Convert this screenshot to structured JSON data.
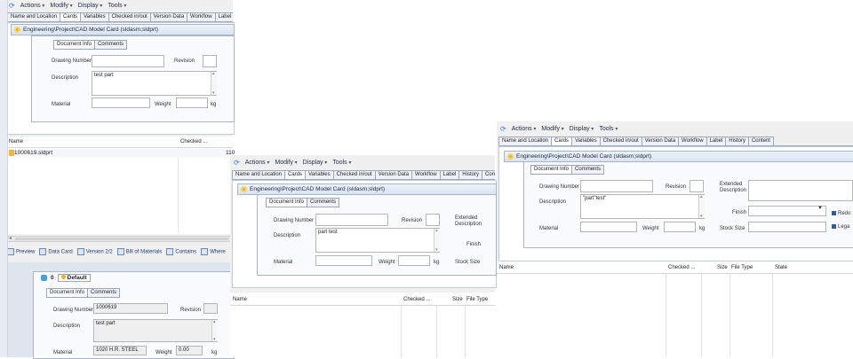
{
  "menu": {
    "actions": "Actions",
    "modify": "Modify",
    "display": "Display",
    "tools": "Tools"
  },
  "tabs": [
    "Name and Location",
    "Cards",
    "Variables",
    "Checked in/out",
    "Version Data",
    "Workflow",
    "Label",
    "History",
    "Content"
  ],
  "tabs_short": [
    "Name and Location",
    "Cards",
    "Variables",
    "Checked in/out",
    "Version Data",
    "Workflow",
    "Label",
    "Hi"
  ],
  "card_title": "Engineering\\Project\\CAD Model Card  (sldasm;sldprt)",
  "subtabs": {
    "doc_info": "Document Info",
    "comments": "Comments"
  },
  "labels": {
    "drawing_number": "Drawing Number",
    "revision": "Revision",
    "description": "Description",
    "material": "Material",
    "weight": "Weight",
    "kg": "kg",
    "extended_description": "Extended Description",
    "finish": "Finish",
    "stock_size": "Stock Size",
    "redo": "Redo",
    "lega": "Lega"
  },
  "win1": {
    "description": "test part",
    "grid_name": "Name",
    "grid_checked": "Checked ...",
    "row_file": "1000619.sldprt",
    "row_val": "110",
    "bottom_tabs": [
      "Preview",
      "Data Card",
      "Version 2/2",
      "Bill of Materials",
      "Contains",
      "Where"
    ],
    "config_zero": "0",
    "config_default": "Default",
    "lower_drawing_number": "1000619",
    "lower_description": "test part",
    "lower_material": "1020 H.R. STEEL",
    "lower_weight": "0.00"
  },
  "win2": {
    "description": "part test",
    "grid_name": "Name",
    "grid_checked": "Checked ...",
    "grid_size": "Size",
    "grid_type": "File Type"
  },
  "win3": {
    "description": "\"part\"test\"",
    "grid_name": "Name",
    "grid_checked": "Checked ...",
    "grid_size": "Size",
    "grid_type": "File Type",
    "grid_state": "State"
  }
}
